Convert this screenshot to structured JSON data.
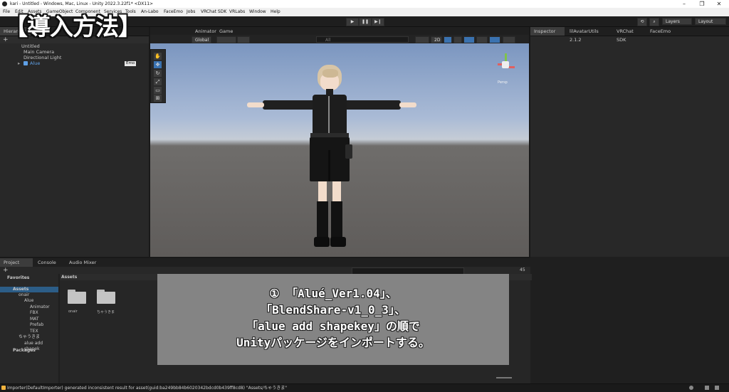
{
  "window": {
    "title": "kari - Untitled - Windows, Mac, Linux - Unity 2022.3.22f1* <DX11>",
    "minimize": "–",
    "maximize": "❐",
    "close": "✕"
  },
  "menu": [
    "File",
    "Edit",
    "Assets",
    "GameObject",
    "Component",
    "Services",
    "Tools",
    "An-Labo",
    "FaceEmo",
    "Jobs",
    "VRChat SDK",
    "VRLabs",
    "Window",
    "Help"
  ],
  "toolbar": {
    "play": "▶",
    "pause": "❚❚",
    "step": "▶❙",
    "history_icon": "⟲",
    "search_icon": "⌕",
    "layers": "Layers",
    "layout": "Layout"
  },
  "headline": "【導入方法】",
  "hierarchy": {
    "tab": "Hierarchy",
    "add": "+",
    "scene": "Untitled",
    "items": [
      "Main Camera",
      "Directional Light",
      "Alue"
    ],
    "badge": "Emo"
  },
  "scene_tabs": [
    "Animator",
    "Game"
  ],
  "scene_toolbar": {
    "global": "Global",
    "search_placeholder": "All",
    "mode_2d": "2D",
    "persp": "Persp"
  },
  "inspector_tabs": [
    "Inspector",
    "lilAvatarUtils 2.1.2",
    "VRChat SDK",
    "FaceEmo"
  ],
  "project": {
    "tabs": [
      "Project",
      "Console",
      "Audio Mixer"
    ],
    "add": "+",
    "favorites": "Favorites",
    "assets_header": "Assets",
    "tree": [
      "Assets",
      "onair",
      "Alue",
      "Animator",
      "FBX",
      "MAT",
      "Prefab",
      "TEX",
      "ちゃうきま",
      "alue add shapek",
      "Packages"
    ],
    "grid_items": [
      "onair",
      "ちゃうきま"
    ],
    "count": "45"
  },
  "overlay": {
    "lines": [
      "① 「Alué_Ver1.04」、",
      "「BlendShare-v1_0_3」、",
      "「alue add shapekey」の順で",
      "Unityパッケージをインポートする。"
    ]
  },
  "status": {
    "message": "Importer(DefaultImporter) generated inconsistent result for asset(guid:ba249bb84b6020342bdcd0b439ff8cd8) \"Assets/ちゃうきま\""
  },
  "colors": {
    "accent_blue": "#3a72b0",
    "warning": "#f2b33d",
    "overlay_bg": "#8c8c8c"
  }
}
